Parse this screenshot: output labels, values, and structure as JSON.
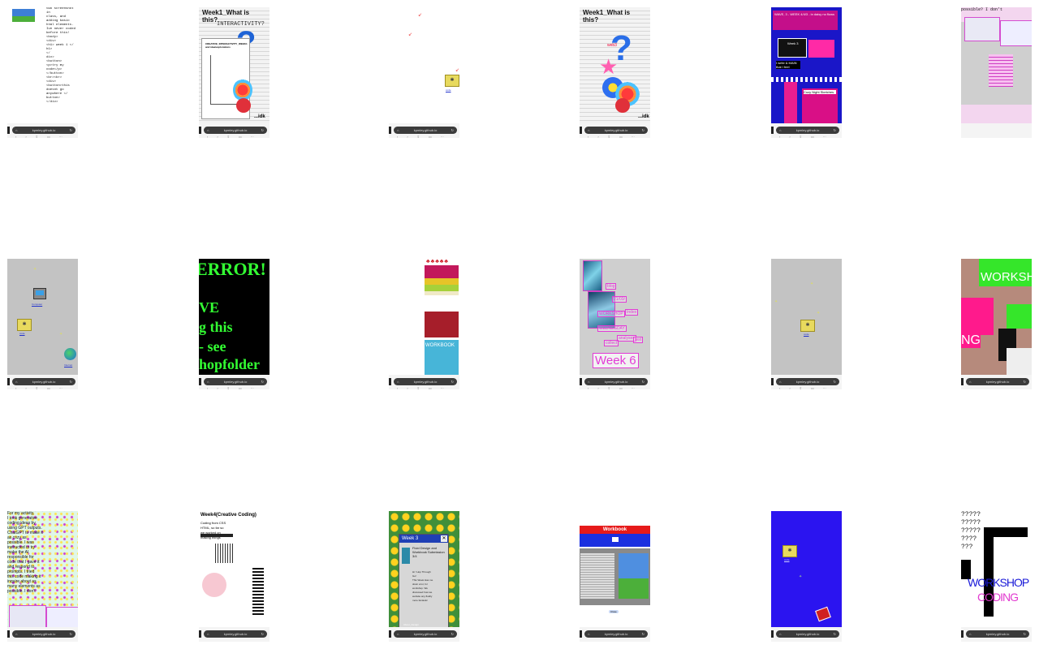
{
  "chrome": {
    "url": "kpmley.github.io"
  },
  "tiles": {
    "t1": {
      "lines": [
        "two screenshot in",
        "class, and",
        "adding basic",
        "html elements.",
        "Ive never coded",
        "before this!",
        "<body>",
        "<div>",
        "<h1> week 1 </",
        "h1>",
        "</",
        "div>",
        "<button>",
        "<p>try my",
        "code</p>",
        "</button>",
        "<br><br>",
        "<div>",
        "<button>this",
        "doesnt go",
        "anywhere </",
        "button>",
        "</div>"
      ]
    },
    "t2": {
      "title": "Week1_What is this?",
      "sub": "INTERACTIVITY?",
      "card": "CREATIVE_INTERACTIVITY_WEEK1 and idea/explorations",
      "idk": "...idk"
    },
    "t3": {
      "folder": "code"
    },
    "t4": {
      "title": "Week1_What is this?",
      "idk": "...idk",
      "tag": "web3"
    },
    "t5": {
      "banner": "WAVE, 3 - WEEK 4/4/3 - in daisy no flows",
      "week": "Week 3",
      "cozy": "Cozy Night Sketches",
      "mark": "I write & MAIN that I feel"
    },
    "t6": {
      "title": "possible? I don't"
    },
    "t7": {
      "icon1": "Computer",
      "icon2": "code",
      "icon3": "Internet"
    },
    "t8": {
      "line1": "ERROR!",
      "line2": "VE",
      "line3": "g this",
      "line4": "- see",
      "line5": "hopfolder"
    },
    "t9": {
      "label": "WORKBOOK"
    },
    "t10": {
      "week": "Week 6",
      "words": [
        "blog",
        "21/03/",
        "Index",
        "WORKSHOP",
        "WEDNESDAY",
        "analyses",
        "collect",
        "test"
      ]
    },
    "t11": {
      "folder": "code"
    },
    "t12": {
      "word1": "WORKSH",
      "word2": "NG"
    },
    "t13": {
      "lines": [
        "For my activity,",
        "I took generative",
        "coding ideas by",
        "using GPT outputs.",
        "ChatGPT to make it",
        "as cozy as",
        "possible. I was",
        "instructed to try",
        "make the AI",
        "responsible for",
        "code that I gave it",
        "and respond to",
        "prompts. I tried",
        "this code making it",
        "inquire about as",
        "many elements as",
        "possible. I don't"
      ]
    },
    "t14": {
      "title": "Week4(Creative Coding)",
      "lines": [
        "Coding from CSS",
        "HTML, so far so",
        "we worked on",
        "making things"
      ]
    },
    "t15": {
      "window": "Week 3",
      "heading": "Fluid Design and Workbook Submission 3/4",
      "body": [
        "Hi ! Hop Through",
        "Go!",
        "This Week Has me",
        "down a lot, for",
        "workshop. We",
        "discussed how we",
        "website any fluidly",
        "more fantastic"
      ],
      "footer": "About_Design"
    },
    "t16": {
      "title": "Workbook",
      "button": "Close"
    },
    "t17": {
      "folder": "code"
    },
    "t18": {
      "q": [
        "?????",
        "?????",
        "?????",
        "????",
        "???"
      ],
      "w1": "WORKSHOP",
      "w2": "CODING"
    }
  }
}
